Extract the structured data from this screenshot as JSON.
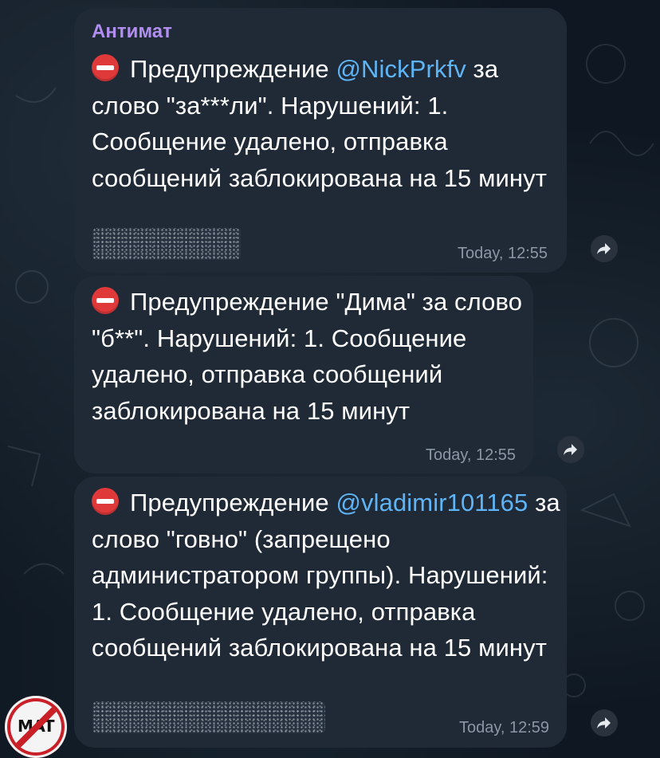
{
  "chat": {
    "messages": [
      {
        "sender": "Антимат",
        "warning_word": "Предупреждение",
        "mention": "@NickPrkfv",
        "text_after": " за слово \"за***ли\". Нарушений: 1. Сообщение удалено, отправка сообщений заблокирована на 15 минут",
        "time": "Today, 12:55",
        "has_spoiler": true
      },
      {
        "warning_text": "Предупреждение \"Дима\" за слово \"б**\". Нарушений: 1. Сообщение удалено, отправка сообщений заблокирована на 15 минут",
        "time": "Today, 12:55",
        "has_spoiler": false
      },
      {
        "warning_word": "Предупреждение",
        "mention": "@vladimir101165",
        "text_after": " за слово \"говно\" (запрещено администратором группы). Нарушений: 1. Сообщение удалено, отправка сообщений заблокирована на 15 минут",
        "time": "Today, 12:59",
        "has_spoiler": true
      }
    ]
  },
  "avatar": {
    "text": "MAT",
    "icon": "no-swearing-sign-icon"
  },
  "colors": {
    "background": "#0f1822",
    "bubble": "#1f2a36",
    "sender": "#b18ef0",
    "mention": "#5fb4f5",
    "time": "#8a97a4",
    "stop_icon": "#e0393a"
  },
  "icons": {
    "stop": "no-entry-emoji-icon",
    "forward": "forward-arrow-icon"
  }
}
